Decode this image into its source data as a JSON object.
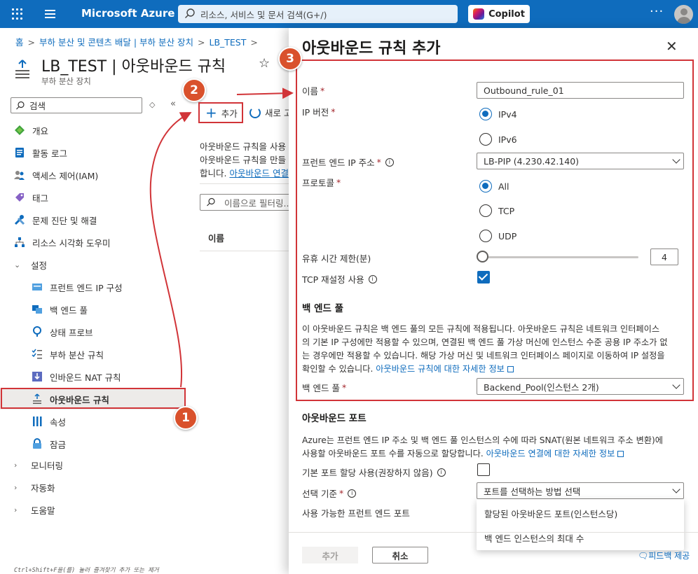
{
  "topbar": {
    "brand": "Microsoft Azure",
    "search_placeholder": "리소스, 서비스 및 문서 검색(G+/)",
    "copilot_label": "Copilot",
    "more_label": "···"
  },
  "breadcrumb": [
    "홈",
    "부하 분산 및 콘텐츠 배달 | 부하 분산 장치",
    "LB_TEST"
  ],
  "breadcrumb_sep": ">",
  "page": {
    "title": "LB_TEST | 아웃바운드 규칙",
    "subtitle": "부하 분산 장치",
    "star": "☆"
  },
  "nav": {
    "search_placeholder": "검색",
    "sort_icon": "◇",
    "collapse_icon": "«",
    "items": [
      {
        "label": "개요",
        "icon": "overview-icon"
      },
      {
        "label": "활동 로그",
        "icon": "activity-log-icon"
      },
      {
        "label": "액세스 제어(IAM)",
        "icon": "iam-icon"
      },
      {
        "label": "태그",
        "icon": "tag-icon"
      },
      {
        "label": "문제 진단 및 해결",
        "icon": "diagnose-icon"
      },
      {
        "label": "리소스 시각화 도우미",
        "icon": "visualizer-icon"
      }
    ],
    "settings_label": "설정",
    "settings_items": [
      {
        "label": "프런트 엔드 IP 구성",
        "icon": "frontend-ip-icon"
      },
      {
        "label": "백 엔드 풀",
        "icon": "backend-pool-icon"
      },
      {
        "label": "상태 프로브",
        "icon": "health-probe-icon"
      },
      {
        "label": "부하 분산 규칙",
        "icon": "lb-rules-icon"
      },
      {
        "label": "인바운드 NAT 규칙",
        "icon": "inbound-nat-icon"
      },
      {
        "label": "아웃바운드 규칙",
        "icon": "outbound-rules-icon"
      },
      {
        "label": "속성",
        "icon": "properties-icon"
      },
      {
        "label": "잠금",
        "icon": "lock-icon"
      }
    ],
    "groups": [
      "모니터링",
      "자동화",
      "도움말"
    ]
  },
  "middle": {
    "add_label": "추가",
    "refresh_label": "새로 고",
    "desc_line1": "아웃바운드 규칙을 사용",
    "desc_line2": "아웃바운드 규칙을 만들",
    "desc_line3": "합니다.",
    "desc_link": "아웃바운드 연결",
    "filter_placeholder": "이름으로 필터링...",
    "col_name": "이름"
  },
  "panel": {
    "title": "아웃바운드 규칙 추가",
    "close": "✕",
    "name_label": "이름",
    "name_value": "Outbound_rule_01",
    "ip_version_label": "IP 버전",
    "ipv4": "IPv4",
    "ipv6": "IPv6",
    "frontend_ip_label": "프런트 엔드 IP 주소",
    "frontend_ip_value": "LB-PIP (4.230.42.140)",
    "protocol_label": "프로토콜",
    "protocol_all": "All",
    "protocol_tcp": "TCP",
    "protocol_udp": "UDP",
    "idle_timeout_label": "유휴 시간 제한(분)",
    "idle_timeout_value": "4",
    "tcp_reset_label": "TCP 재설정 사용",
    "backend_pool_heading": "백 엔드 풀",
    "backend_desc_1": "이 아웃바운드 규칙은 백 엔드 풀의 모든 규칙에 적용됩니다. 아웃바운드 규칙은 네트워크 인터페이스",
    "backend_desc_2": "의 기본 IP 구성에만 적용할 수 있으며, 연결된 백 엔드 풀 가상 머신에 인스턴스 수준 공용 IP 주소가 없",
    "backend_desc_3": "는 경우에만 적용할 수 있습니다. 해당 가상 머신 및 네트워크 인터페이스 페이지로 이동하여 IP 설정을",
    "backend_desc_4": "확인할 수 있습니다.",
    "backend_desc_link": "아웃바운드 규칙에 대한 자세한 정보",
    "backend_pool_label": "백 엔드 풀",
    "backend_pool_value": "Backend_Pool(인스턴스 2개)",
    "outbound_ports_heading": "아웃바운드 포트",
    "ports_desc_1": "Azure는 프런트 엔드 IP 주소 및 백 엔드 풀 인스턴스의 수에 따라 SNAT(원본 네트워크 주소 변환)에",
    "ports_desc_2": "사용할 아웃바운드 포트 수를 자동으로 할당합니다.",
    "ports_desc_link": "아웃바운드 연결에 대한 자세한 정보",
    "default_port_label": "기본 포트 할당 사용(권장하지 않음)",
    "select_by_label": "선택 기준",
    "select_by_placeholder": "포트를 선택하는 방법 선택",
    "available_ports_label": "사용 가능한 프런트 엔드 포트",
    "dropdown_options": [
      "할당된 아웃바운드 포트(인스턴스당)",
      "백 엔드 인스턴스의 최대 수"
    ],
    "add_button": "추가",
    "cancel_button": "취소",
    "feedback": "피드백 제공"
  },
  "shortcut_hint": "Ctrl+Shift+F을(를) 눌러 즐겨찾기 추가 또는 제거",
  "annotations": [
    "1",
    "2",
    "3"
  ],
  "colors": {
    "accent": "#0f6cbd",
    "highlight": "#d13438",
    "badge": "#d9512c"
  }
}
